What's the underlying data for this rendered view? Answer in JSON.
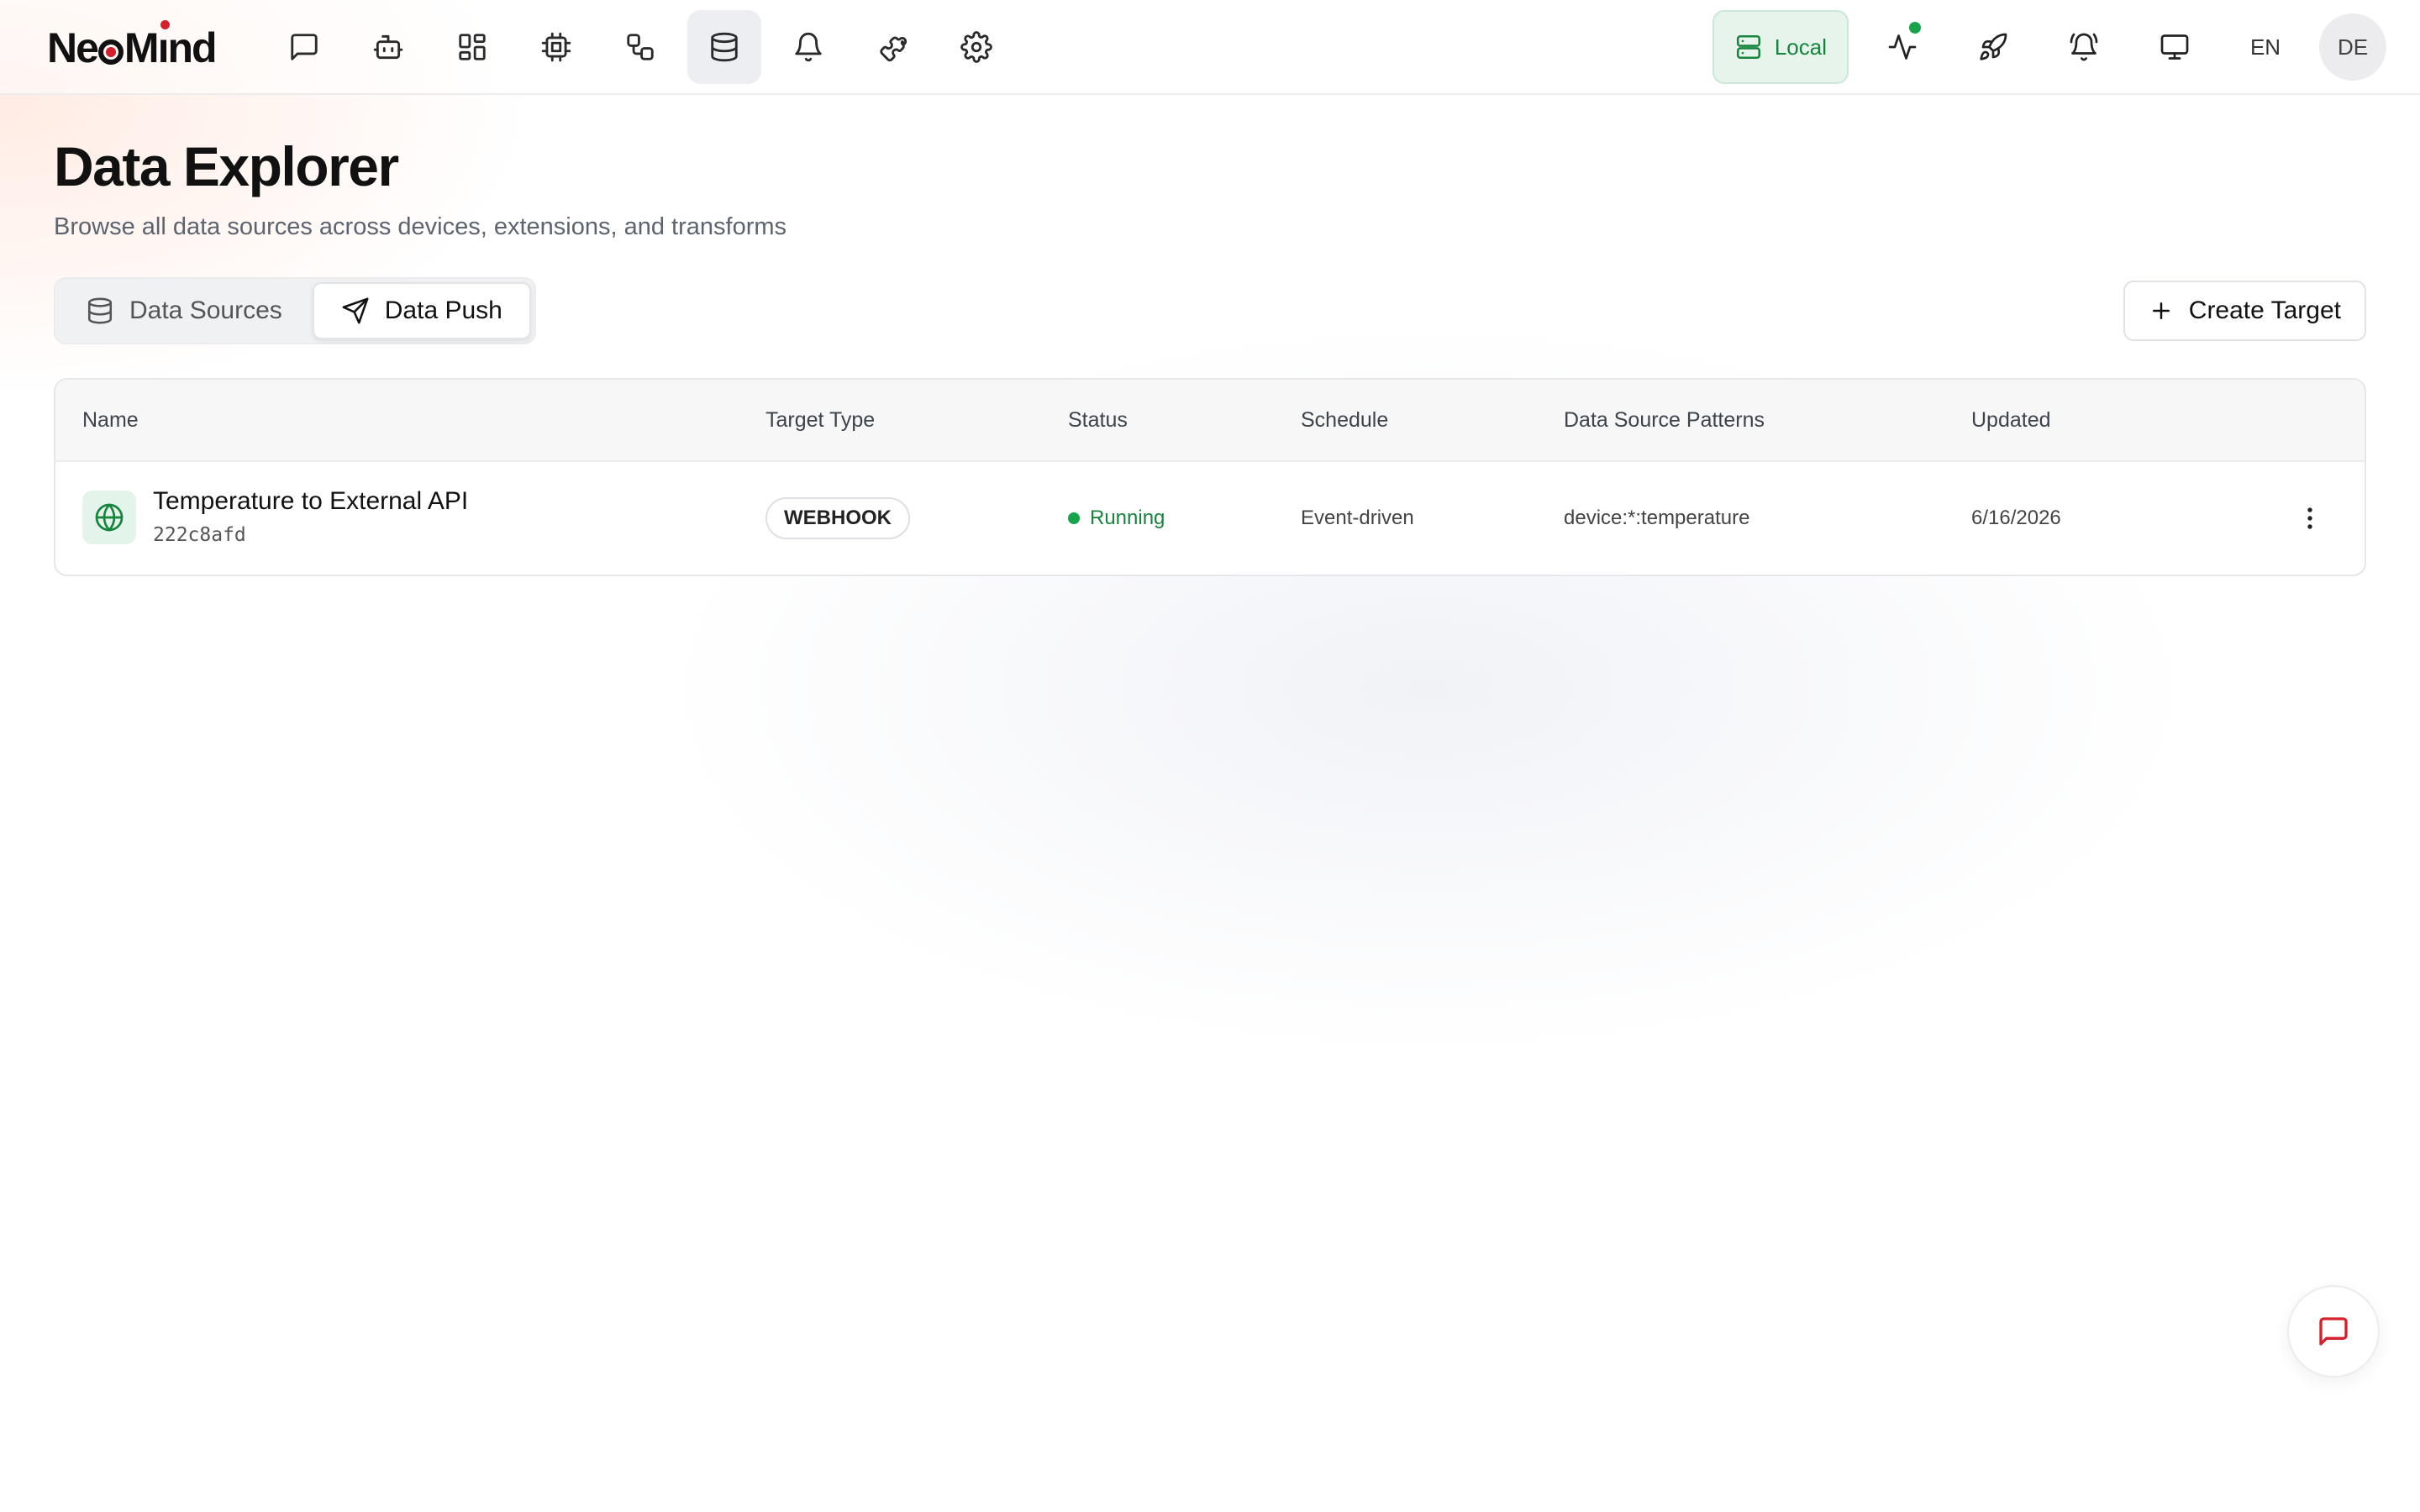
{
  "app": {
    "logo_pre": "Ne",
    "logo_mid": "M",
    "logo_i": "ı",
    "logo_post": "nd"
  },
  "nav": {
    "icons": [
      {
        "name": "chat-icon"
      },
      {
        "name": "robot-icon"
      },
      {
        "name": "dashboard-icon"
      },
      {
        "name": "chip-icon"
      },
      {
        "name": "workflow-icon"
      },
      {
        "name": "database-icon",
        "active": true
      },
      {
        "name": "bell-icon"
      },
      {
        "name": "puzzle-icon"
      },
      {
        "name": "gear-icon"
      }
    ]
  },
  "toolbar": {
    "local_label": "Local",
    "lang": "EN",
    "avatar_initials": "DE",
    "status_color": "#16a34a"
  },
  "page": {
    "title": "Data Explorer",
    "subtitle": "Browse all data sources across devices, extensions, and transforms"
  },
  "tabs": [
    {
      "label": "Data Sources",
      "icon": "database-icon",
      "active": false
    },
    {
      "label": "Data Push",
      "icon": "send-icon",
      "active": true
    }
  ],
  "actions": {
    "create_label": "Create Target"
  },
  "table": {
    "columns": [
      "Name",
      "Target Type",
      "Status",
      "Schedule",
      "Data Source Patterns",
      "Updated"
    ],
    "rows": [
      {
        "name": "Temperature to External API",
        "id": "222c8afd",
        "type": "WEBHOOK",
        "status": "Running",
        "schedule": "Event-driven",
        "patterns": "device:*:temperature",
        "updated": "6/16/2026"
      }
    ]
  },
  "colors": {
    "accent_green": "#16843d",
    "brand_red": "#d4202a"
  }
}
